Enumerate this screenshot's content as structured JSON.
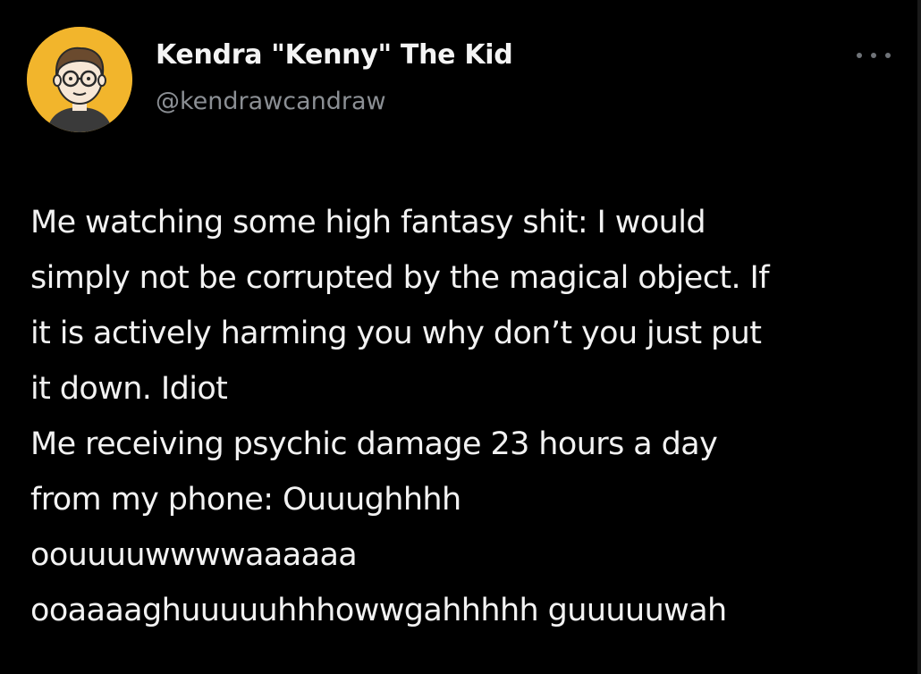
{
  "author": {
    "display_name": "Kendra \"Kenny\" The Kid",
    "handle": "@kendrawcandraw",
    "avatar_icon": "cartoon-avatar-icon",
    "avatar_bg": "#f2b52c"
  },
  "more_icon": "more-options-icon",
  "tweet": {
    "lines": [
      "Me watching some high fantasy shit: I would",
      "simply not be corrupted by the magical object. If",
      "it is actively harming you why don’t you just put",
      "it down. Idiot",
      "Me receiving psychic damage 23 hours a day",
      "from my phone: Ouuughhhh",
      "oouuuuwwwwaaaaaa",
      "ooaaaaghuuuuuhhhowwgahhhhh guuuuuwah"
    ]
  }
}
